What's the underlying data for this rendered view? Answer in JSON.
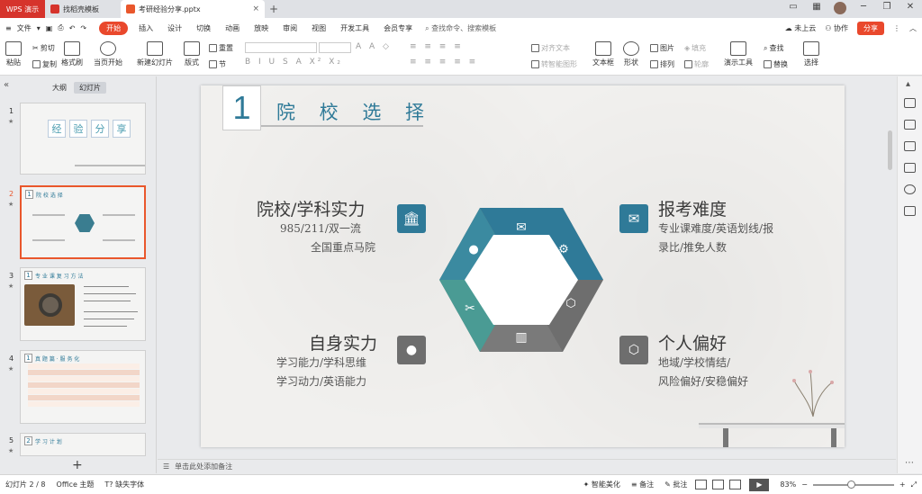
{
  "tabs": {
    "wps": "WPS 演示",
    "template": "找稻壳模板",
    "document": "考研经验分享.pptx"
  },
  "menubar": {
    "file": "文件",
    "items": [
      "开始",
      "插入",
      "设计",
      "切换",
      "动画",
      "放映",
      "审阅",
      "视图",
      "开发工具",
      "会员专享"
    ],
    "active_index": 0,
    "search": "查找命令、搜索模板",
    "cloud": "未上云",
    "collab": "协作",
    "share": "分享"
  },
  "ribbon": {
    "paste": "粘贴",
    "cut": "剪切",
    "copy": "复制",
    "format_painter": "格式刷",
    "from_current": "当页开始",
    "new_slide": "新建幻灯片",
    "layout": "版式",
    "section": "节",
    "reset": "重置",
    "align_text": "对齐文本",
    "convert_smartart": "转智能图形",
    "textbox": "文本框",
    "shape": "形状",
    "picture": "图片",
    "fill": "填充",
    "arrange": "排列",
    "outline": "轮廓",
    "present_tools": "演示工具",
    "find": "查找",
    "replace": "替换",
    "select": "选择"
  },
  "panel": {
    "outline_tab": "大纲",
    "slides_tab": "幻灯片",
    "thumb1_title": [
      "经",
      "验",
      "分",
      "享"
    ],
    "thumb_numbers": [
      "1",
      "2",
      "3",
      "4",
      "5"
    ],
    "thumb2_head": "院 校 选 择",
    "thumb3_head": "专 业 课 复 习 方 法",
    "thumb4_head": "真 题 篇 · 服 务 化",
    "thumb5_head": "学 习 计 划"
  },
  "slide": {
    "number": "1",
    "title": "院 校 选 择",
    "block1": {
      "heading": "院校/学科实力",
      "line1": "985/211/双一流",
      "line2": "全国重点马院"
    },
    "block2": {
      "heading": "报考难度",
      "line1": "专业课难度/英语划线/报",
      "line2": "录比/推免人数"
    },
    "block3": {
      "heading": "自身实力",
      "line1": "学习能力/学科思维",
      "line2": "学习动力/英语能力"
    },
    "block4": {
      "heading": "个人偏好",
      "line1": "地域/学校情结/",
      "line2": "风险偏好/安稳偏好"
    }
  },
  "notes_placeholder": "单击此处添加备注",
  "status": {
    "slide_pos": "幻灯片 2 / 8",
    "theme": "Office 主题",
    "missing_font": "缺失字体",
    "smart_beautify": "智能美化",
    "notes": "备注",
    "comments": "批注",
    "zoom": "83%"
  },
  "colors": {
    "accent": "#e9482c",
    "teal": "#2f7a98",
    "grey": "#6e6e6e"
  }
}
